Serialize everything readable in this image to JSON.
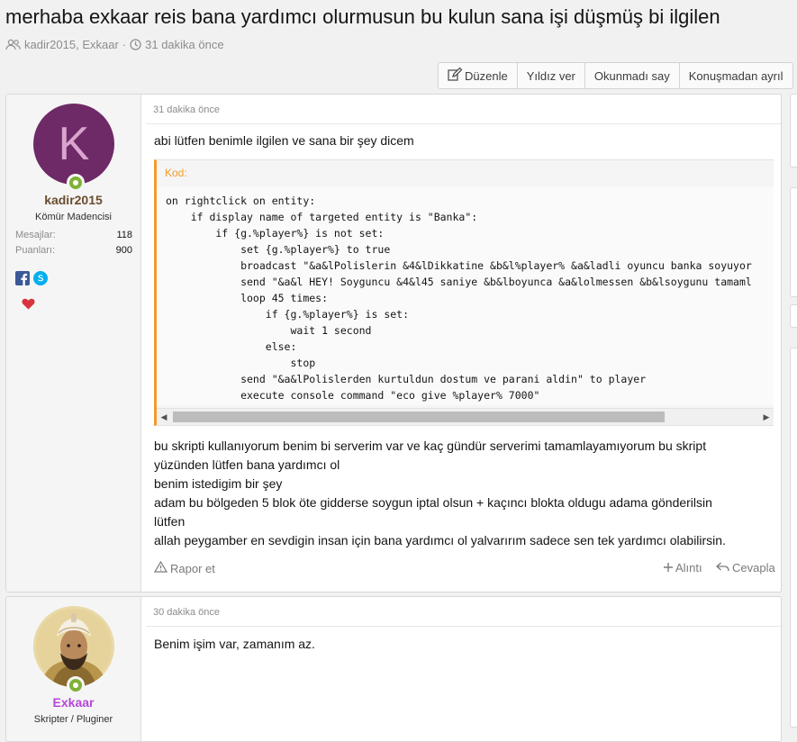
{
  "thread": {
    "title": "merhaba exkaar reis bana yardımcı olurmusun bu kulun sana işi düşmüş bi ilgilen",
    "meta_authors": "kadir2015, Exkaar",
    "meta_separator": "·",
    "meta_time": "31 dakika önce",
    "actions": {
      "edit": "Düzenle",
      "rate": "Yıldız ver",
      "mark_unread": "Okunmadı say",
      "leave": "Konuşmadan ayrıl"
    }
  },
  "posts": [
    {
      "avatar_letter": "K",
      "username": "kadir2015",
      "user_title": "Kömür Madencisi",
      "stats": {
        "messages_label": "Mesajlar:",
        "messages_value": "118",
        "points_label": "Puanları:",
        "points_value": "900"
      },
      "date": "31 dakika önce",
      "intro": "abi lütfen benimle ilgilen ve sana bir şey dicem",
      "code_label": "Kod:",
      "code_lines": [
        "on rightclick on entity:",
        "    if display name of targeted entity is \"Banka\":",
        "        if {g.%player%} is not set:",
        "            set {g.%player%} to true",
        "            broadcast \"&a&lPolislerin &4&lDikkatine &b&l%player% &a&ladli oyuncu banka soyuyor",
        "            send \"&a&l HEY! Soyguncu &4&l45 saniye &b&lboyunca &a&lolmessen &b&lsoygunu tamaml",
        "            loop 45 times:",
        "                if {g.%player%} is set:",
        "                    wait 1 second",
        "                else:",
        "                    stop",
        "            send \"&a&lPolislerden kurtuldun dostum ve parani aldin\" to player",
        "            execute console command \"eco give %player% 7000\""
      ],
      "body_lines": [
        "bu skripti kullanıyorum benim bi serverim var ve kaç gündür serverimi tamamlayamıyorum bu skript",
        "yüzünden lütfen bana yardımcı ol",
        "benim istedigim bir şey",
        "adam bu bölgeden 5 blok öte gidderse soygun iptal olsun + kaçıncı blokta oldugu adama gönderilsin",
        "lütfen",
        "allah peygamber en sevdigin insan için bana yardımcı ol yalvarırım sadece sen tek yardımcı olabilirsin."
      ],
      "footer": {
        "report": "Rapor et",
        "quote": "Alıntı",
        "reply": "Cevapla"
      }
    },
    {
      "username": "Exkaar",
      "user_title": "Skripter / Pluginer",
      "date": "30 dakika önce",
      "body": "Benim işim var, zamanım az."
    }
  ],
  "colors": {
    "code_accent": "#f39a2b",
    "avatar_bg": "#6e2a66",
    "online": "#7fb136",
    "username_1": "#6a4c2e",
    "username_2": "#b648d8"
  }
}
